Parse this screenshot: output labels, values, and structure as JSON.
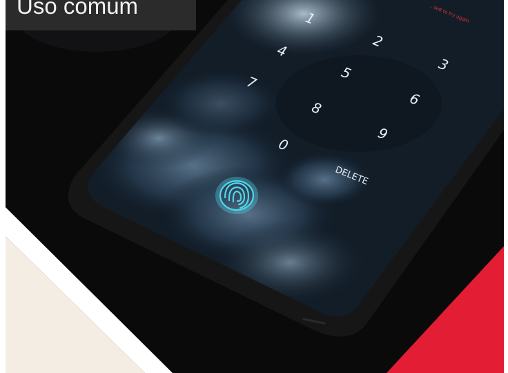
{
  "slide": {
    "title": "Uso comum"
  },
  "keypad": {
    "keys": [
      "1",
      "2",
      "3",
      "4",
      "5",
      "6",
      "7",
      "8",
      "9",
      "0"
    ],
    "delete_label": "DELETE",
    "status_text": "...ted to try again"
  },
  "icons": {
    "fingerprint": "fingerprint-icon"
  },
  "colors": {
    "accent_red": "#e31d34",
    "cream": "#f3ede3",
    "fingerprint_glow": "#4fd6ea"
  }
}
